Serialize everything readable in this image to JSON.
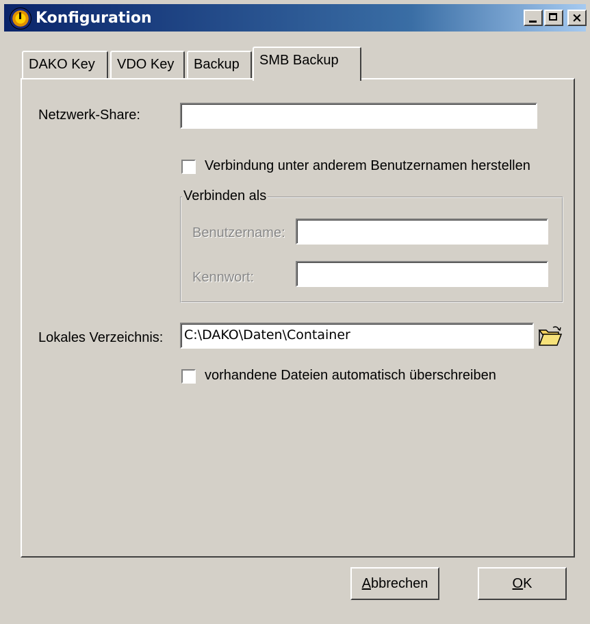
{
  "window": {
    "title": "Konfiguration"
  },
  "titlebar_buttons": {
    "close_label": "×"
  },
  "tabs": [
    {
      "label": "DAKO Key"
    },
    {
      "label": "VDO Key"
    },
    {
      "label": "Backup"
    },
    {
      "label": "SMB Backup",
      "active": true
    }
  ],
  "form": {
    "network_share_label": "Netzwerk-Share:",
    "network_share_value": "",
    "connect_other_user_label": "Verbindung unter anderem Benutzernamen herstellen",
    "connect_other_user_checked": false,
    "group_title": "Verbinden als",
    "username_label": "Benutzername:",
    "username_value": "",
    "password_label": "Kennwort:",
    "password_value": "",
    "local_dir_label": "Lokales Verzeichnis:",
    "local_dir_value": "C:\\DAKO\\Daten\\Container",
    "overwrite_label": "vorhandene Dateien automatisch überschreiben",
    "overwrite_checked": false,
    "browse_icon": "folder-open-icon"
  },
  "buttons": {
    "cancel_prefix": "A",
    "cancel_rest": "bbrechen",
    "ok_prefix": "O",
    "ok_rest": "K"
  }
}
